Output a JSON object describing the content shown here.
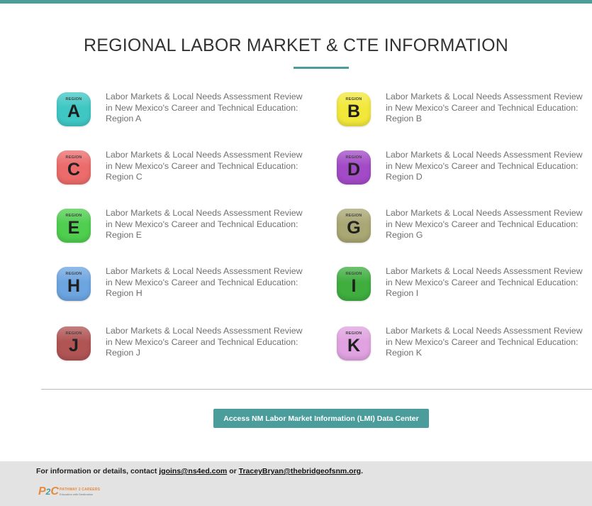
{
  "page": {
    "title": "REGIONAL LABOR MARKET & CTE INFORMATION"
  },
  "badge_word": "REGION",
  "regions": [
    {
      "letter": "A",
      "label": "Labor Markets & Local Needs Assessment Review in New Mexico's Career and Technical Education: Region A",
      "color": "#3fc7c4"
    },
    {
      "letter": "B",
      "label": "Labor Markets & Local Needs Assessment Review in New Mexico's Career and Technical Education: Region B",
      "color": "#f2e83a"
    },
    {
      "letter": "C",
      "label": "Labor Markets & Local Needs Assessment Review in New Mexico's Career and Technical Education: Region C",
      "color": "#ec6b6b"
    },
    {
      "letter": "D",
      "label": "Labor Markets & Local Needs Assessment Review in New Mexico's Career and Technical Education: Region D",
      "color": "#a34ac7"
    },
    {
      "letter": "E",
      "label": "Labor Markets & Local Needs Assessment Review in New Mexico's Career and Technical Education: Region E",
      "color": "#4fce4f"
    },
    {
      "letter": "G",
      "label": "Labor Markets & Local Needs Assessment Review in New Mexico's Career and Technical Education: Region G",
      "color": "#a9a773"
    },
    {
      "letter": "H",
      "label": "Labor Markets & Local Needs Assessment Review in New Mexico's Career and Technical Education: Region H",
      "color": "#6da5e0"
    },
    {
      "letter": "I",
      "label": "Labor Markets & Local Needs Assessment Review in New Mexico's Career and Technical Education: Region I",
      "color": "#3fae3f"
    },
    {
      "letter": "J",
      "label": "Labor Markets & Local Needs Assessment Review in New Mexico's Career and Technical Education: Region J",
      "color": "#b05454"
    },
    {
      "letter": "K",
      "label": "Labor Markets & Local Needs Assessment Review in New Mexico's Career and Technical Education: Region K",
      "color": "#e0a2e0"
    }
  ],
  "lmi_button": {
    "label": "Access NM Labor Market Information (LMI) Data Center"
  },
  "footer": {
    "prefix": "For information or details, contact ",
    "email1": "jgoins@ns4ed.com",
    "middle": " or ",
    "email2": "TraceyBryan@thebridgeofsnm.org",
    "suffix": ".",
    "logo_mark_p": "P",
    "logo_mark_2": "2",
    "logo_mark_c": "C",
    "logo_line1": "PATHWAY 2 CAREERS",
    "logo_line2": "Education with Destination"
  },
  "colors": {
    "accent": "#4a9d9b",
    "footer_bg": "#e3e3e3"
  }
}
